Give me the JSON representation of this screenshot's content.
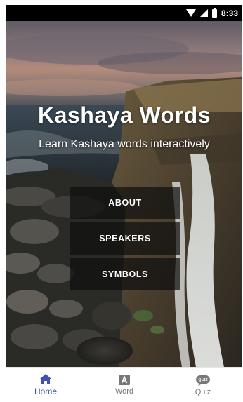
{
  "status_bar": {
    "time": "8:33",
    "icons": [
      "wifi-icon",
      "signal-icon",
      "battery-icon"
    ]
  },
  "hero": {
    "title": "Kashaya Words",
    "subtitle": "Learn Kashaya words interactively"
  },
  "menu": {
    "about_label": "ABOUT",
    "speakers_label": "SPEAKERS",
    "symbols_label": "SYMBOLS"
  },
  "bottom_nav": {
    "items": [
      {
        "label": "Home",
        "icon": "home-icon",
        "active": true
      },
      {
        "label": "Word",
        "icon": "word-icon",
        "active": false
      },
      {
        "label": "Quiz",
        "icon": "quiz-icon",
        "active": false
      }
    ],
    "active_color": "#3f51b5",
    "inactive_color": "#777777"
  },
  "colors": {
    "button_bg": "rgba(15,15,15,0.72)",
    "status_bar_bg": "#000000"
  }
}
